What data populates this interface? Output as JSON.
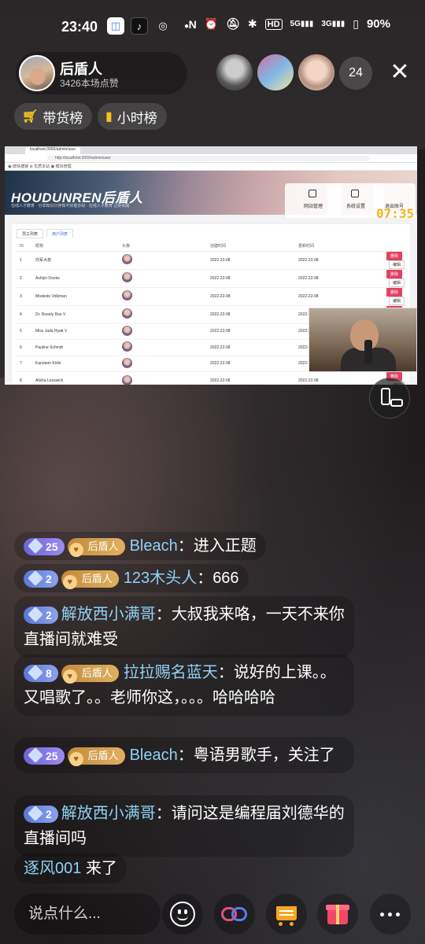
{
  "status_bar": {
    "time": "23:40",
    "network_5g": "5G",
    "network_3g": "3G",
    "hd": "HD",
    "battery": "90%"
  },
  "host": {
    "name": "后盾人",
    "likes": "3426本场点赞"
  },
  "viewer_count": "24",
  "pills": {
    "shop_rank": "带货榜",
    "hour_rank": "小时榜"
  },
  "stream": {
    "tab_title": "localhost:3000/admin/user",
    "url": "http://localhost:3000/admin/user",
    "bookmarks": "▣ 蹭快捷链   ⊕ 优质本站   ▣ 模块管理",
    "logo": "HOUDUNREN后盾人",
    "slogan": "在线人才教育 · 分享知识只存知不好能办好 · 在线人才教育 让好实践",
    "menu": [
      "网站管理",
      "系统设置",
      "退出账号"
    ],
    "timer": "07:35",
    "tabs": [
      "员工列表",
      "用户列表"
    ],
    "columns": [
      "ID",
      "昵称",
      "头像",
      "创建时间",
      "更新时间",
      ""
    ],
    "rows": [
      {
        "id": "1",
        "name": "向军大叔",
        "created": "2022-22-08",
        "updated": "2022-22-08"
      },
      {
        "id": "2",
        "name": "Ashlyn Dooke",
        "created": "2022-22-08",
        "updated": "2022-22-08"
      },
      {
        "id": "3",
        "name": "Modesto Volkman",
        "created": "2022-22-08",
        "updated": "2022-22-08"
      },
      {
        "id": "4",
        "name": "Dr. Rosely Roe V",
        "created": "2022-22-08",
        "updated": "2022-22-08"
      },
      {
        "id": "5",
        "name": "Miss Jada Hyatt V",
        "created": "2022-22-08",
        "updated": "2022-22-08"
      },
      {
        "id": "6",
        "name": "Pauline Schmitt",
        "created": "2022-22-08",
        "updated": "2022-22-08"
      },
      {
        "id": "7",
        "name": "Karolann Kirlin",
        "created": "2022-22-08",
        "updated": "2022-22-08"
      },
      {
        "id": "8",
        "name": "Alisha Lesswick",
        "created": "2022-22-08",
        "updated": "2022-22-08"
      }
    ],
    "delete_label": "删除",
    "edit_label": "编辑"
  },
  "chat": [
    {
      "level": "25",
      "fan": "后盾人",
      "user": "Bleach",
      "text": "进入正题"
    },
    {
      "level": "2",
      "fan": "后盾人",
      "user": "123木头人",
      "text": "666"
    },
    {
      "level": "2",
      "fan": "",
      "user": "解放西小满哥",
      "text": "大叔我来咯，一天不来你直播间就难受"
    },
    {
      "level": "8",
      "fan": "后盾人",
      "user": "拉拉赐名蓝天",
      "text": "说好的上课。。又唱歌了。。老师你这，。。。哈哈哈哈"
    },
    {
      "level": "25",
      "fan": "后盾人",
      "user": "Bleach",
      "text": "粤语男歌手，关注了"
    },
    {
      "level": "2",
      "fan": "",
      "user": "解放西小满哥",
      "text": "请问这是编程届刘德华的直播间吗"
    }
  ],
  "enter": {
    "user": "逐风001",
    "text": "来了"
  },
  "input_placeholder": "说点什么...",
  "colors": {
    "accent_yellow": "#f5c31c",
    "username_blue": "#8fd3f5",
    "delete_red": "#e4405f",
    "timer": "#f2b51e"
  }
}
